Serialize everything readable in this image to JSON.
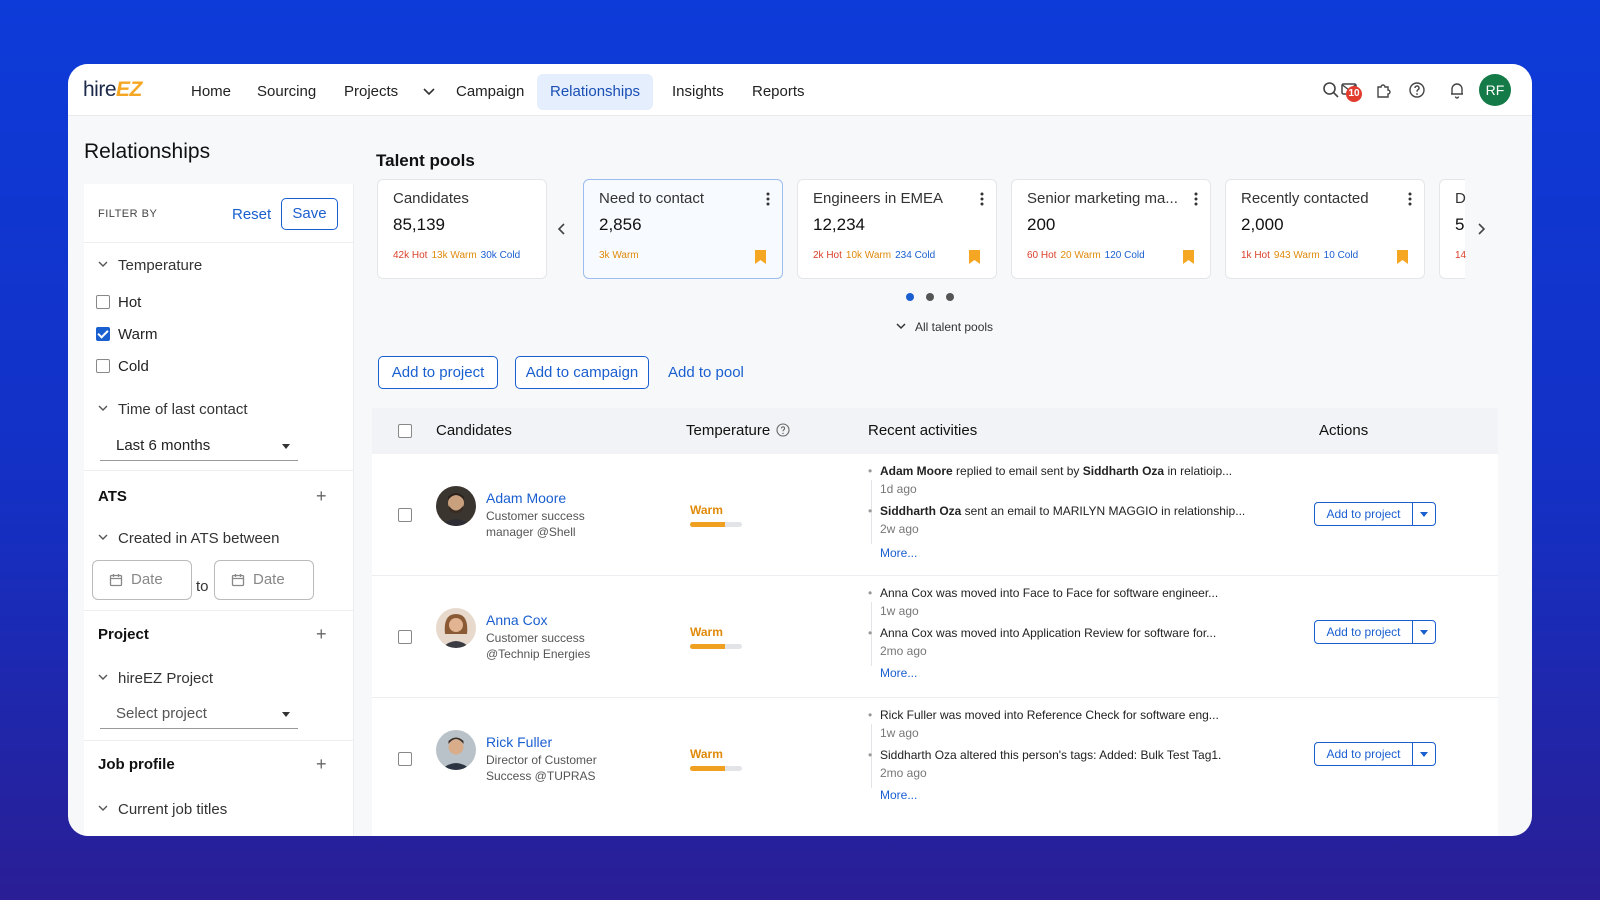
{
  "nav": {
    "logo_part1": "hire",
    "logo_part2": "EZ",
    "items": [
      {
        "label": "Home"
      },
      {
        "label": "Sourcing"
      },
      {
        "label": "Projects"
      },
      {
        "label": "Campaign"
      },
      {
        "label": "Relationships"
      },
      {
        "label": "Insights"
      },
      {
        "label": "Reports"
      }
    ],
    "active": "Relationships",
    "inbox_badge": "10",
    "avatar_initials": "RF",
    "icons": [
      "search-icon",
      "mail-icon",
      "extension-icon",
      "help-icon",
      "bell-icon"
    ]
  },
  "page": {
    "title": "Relationships"
  },
  "sidebar": {
    "filter_by": "FILTER BY",
    "reset": "Reset",
    "save": "Save",
    "temperature": {
      "heading": "Temperature",
      "options": [
        {
          "label": "Hot",
          "checked": false
        },
        {
          "label": "Warm",
          "checked": true
        },
        {
          "label": "Cold",
          "checked": false
        }
      ]
    },
    "last_contact": {
      "heading": "Time of last contact",
      "value": "Last 6 months"
    },
    "ats": {
      "heading": "ATS",
      "sub_heading": "Created in ATS between",
      "date_from_placeholder": "Date",
      "to": "to",
      "date_to_placeholder": "Date"
    },
    "project": {
      "heading": "Project",
      "sub_heading": "hireEZ Project",
      "select_placeholder": "Select project"
    },
    "job_profile": {
      "heading": "Job profile",
      "sub_heading": "Current job titles"
    }
  },
  "talent_pools": {
    "title": "Talent pools",
    "cards": [
      {
        "name": "Candidates",
        "count": "85,139",
        "hot": "42k Hot",
        "warm": "13k Warm",
        "cold": "30k Cold"
      },
      {
        "name": "Need to contact",
        "count": "2,856",
        "hot": "",
        "warm": "3k Warm",
        "cold": ""
      },
      {
        "name": "Engineers in EMEA",
        "count": "12,234",
        "hot": "2k Hot",
        "warm": "10k Warm",
        "cold": "234 Cold"
      },
      {
        "name": "Senior marketing ma...",
        "count": "200",
        "hot": "60 Hot",
        "warm": "20 Warm",
        "cold": "120 Cold"
      },
      {
        "name": "Recently contacted",
        "count": "2,000",
        "hot": "1k Hot",
        "warm": "943 Warm",
        "cold": "10 Cold"
      },
      {
        "name": "D",
        "count": "5",
        "hot": "14",
        "warm": "",
        "cold": ""
      }
    ],
    "pages": 3,
    "active_page": 1,
    "all_pools": "All talent pools"
  },
  "actions": {
    "add_to_project": "Add to project",
    "add_to_campaign": "Add to campaign",
    "add_to_pool": "Add to pool"
  },
  "table": {
    "headers": {
      "candidates": "Candidates",
      "temperature": "Temperature",
      "recent_activities": "Recent activities",
      "actions": "Actions"
    },
    "rows": [
      {
        "name": "Adam Moore",
        "title": "Customer success manager @Shell",
        "temperature": "Warm",
        "temperature_level": 0.67,
        "activity1": {
          "actor": "Adam Moore",
          "text": " replied to email sent by ",
          "target": "Siddharth Oza",
          "rest": " in relatioip...",
          "time": "1d ago"
        },
        "activity2": {
          "actor": "Siddharth Oza",
          "text": " sent an email to MARILYN MAGGIO in relationship...",
          "time": "2w ago"
        },
        "more": "More...",
        "action": "Add to project"
      },
      {
        "name": "Anna Cox",
        "title": "Customer success @Technip Energies",
        "temperature": "Warm",
        "temperature_level": 0.67,
        "activity1": {
          "text": "Anna Cox was moved into Face to Face for software engineer...",
          "time": "1w ago"
        },
        "activity2": {
          "text": "Anna Cox was moved into Application Review for software  for...",
          "time": "2mo ago"
        },
        "more": "More...",
        "action": "Add to project"
      },
      {
        "name": "Rick Fuller",
        "title": "Director of Customer Success @TUPRAS",
        "temperature": "Warm",
        "temperature_level": 0.67,
        "activity1": {
          "text": "Rick Fuller was moved into Reference Check for software eng...",
          "time": "1w ago"
        },
        "activity2": {
          "text": "Siddharth Oza altered this person's tags: Added: Bulk Test Tag1.",
          "time": "2mo ago"
        },
        "more": "More...",
        "action": "Add to project"
      }
    ]
  },
  "colors": {
    "accent": "#1a5fd0",
    "hot": "#d9412b",
    "warm": "#e08a0a",
    "cold": "#1a5fd0"
  }
}
